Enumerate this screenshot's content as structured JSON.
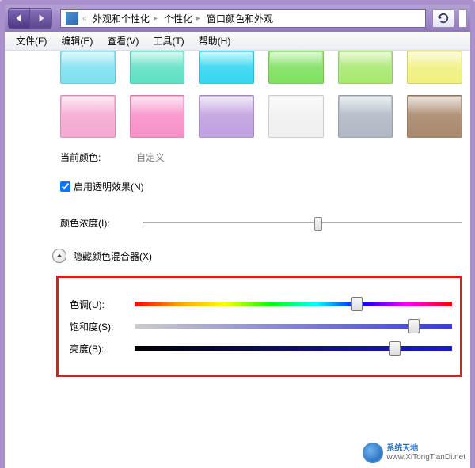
{
  "breadcrumb": {
    "items": [
      "外观和个性化",
      "个性化",
      "窗口颜色和外观"
    ]
  },
  "menubar": {
    "file": "文件(F)",
    "edit": "编辑(E)",
    "view": "查看(V)",
    "tools": "工具(T)",
    "help": "帮助(H)"
  },
  "swatches_row1": [
    "#7fe0f0",
    "#60e0c4",
    "#34d6f0",
    "#80e060",
    "#a8e870",
    "#f0f080"
  ],
  "swatches_row2": [
    "#f4a8d0",
    "#f890c8",
    "#c0a0e0",
    "#f0f0f0",
    "#b0b8c4",
    "#a8886c"
  ],
  "current_color": {
    "label": "当前颜色:",
    "value": "自定义"
  },
  "transparency": {
    "checked": true,
    "label": "启用透明效果(N)"
  },
  "intensity": {
    "label": "颜色浓度(I):",
    "value": 55
  },
  "mixer_toggle": {
    "label": "隐藏颜色混合器(X)"
  },
  "mixer": {
    "hue": {
      "label": "色调(U):",
      "value": 70
    },
    "saturation": {
      "label": "饱和度(S):",
      "value": 88
    },
    "brightness": {
      "label": "亮度(B):",
      "value": 82
    }
  },
  "watermark": {
    "title": "系统天地",
    "url": "www.XiTongTianDi.net"
  }
}
